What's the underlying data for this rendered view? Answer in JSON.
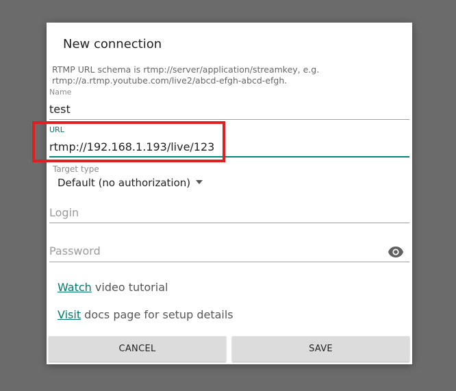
{
  "dialog": {
    "title": "New connection",
    "hint": "RTMP URL schema is rtmp://server/application/streamkey, e.g. rtmp://a.rtmp.youtube.com/live2/abcd-efgh-abcd-efgh."
  },
  "fields": {
    "name": {
      "label": "Name",
      "value": "test"
    },
    "url": {
      "label": "URL",
      "value": "rtmp://192.168.1.193/live/123"
    },
    "target_type": {
      "label": "Target type",
      "selected": "Default (no authorization)"
    },
    "login": {
      "placeholder": "Login"
    },
    "password": {
      "placeholder": "Password",
      "toggle_icon": "eye-icon"
    }
  },
  "links": {
    "watch": {
      "link_text": "Watch",
      "rest": " video tutorial"
    },
    "visit": {
      "link_text": "Visit",
      "rest": " docs page for setup details"
    }
  },
  "buttons": {
    "cancel": "CANCEL",
    "save": "SAVE"
  },
  "colors": {
    "accent": "#00796b",
    "highlight": "#e02020",
    "backdrop": "#6b6b6b"
  }
}
